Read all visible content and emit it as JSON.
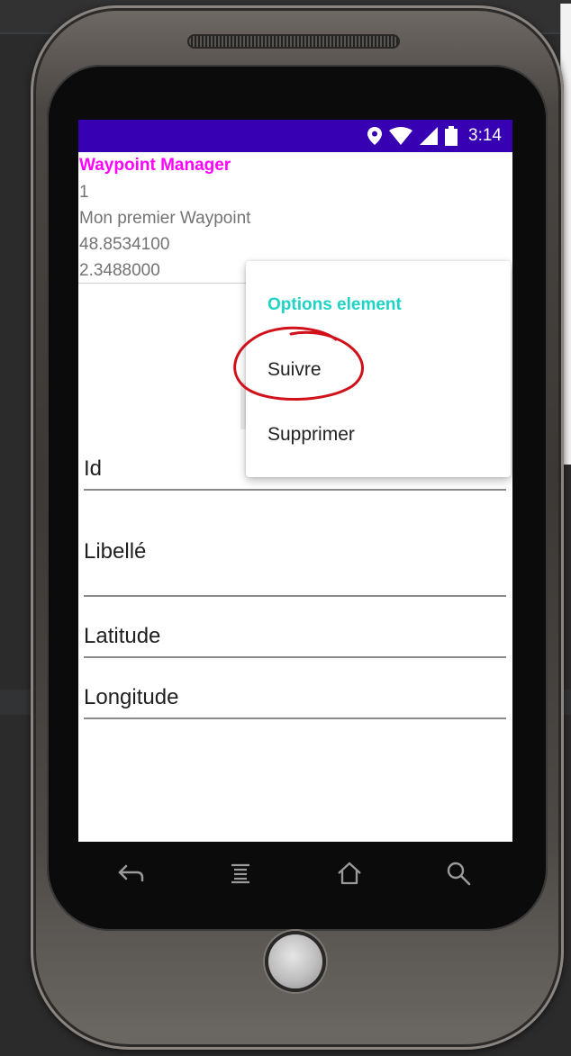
{
  "status_bar": {
    "time": "3:14",
    "background_color": "#3700b3",
    "icons": [
      "location-icon",
      "wifi-icon",
      "signal-icon",
      "battery-icon"
    ]
  },
  "app": {
    "title": "Waypoint Manager",
    "title_color": "#ff00ff",
    "item": {
      "id": "1",
      "label": "Mon premier Waypoint",
      "latitude": "48.8534100",
      "longitude": "2.3488000"
    }
  },
  "form": {
    "id_label": "Id",
    "label_label": "Libellé",
    "latitude_label": "Latitude",
    "longitude_label": "Longitude"
  },
  "context_menu": {
    "header": "Options element",
    "header_color": "#1fd3c4",
    "items": [
      {
        "label": "Suivre"
      },
      {
        "label": "Supprimer"
      }
    ]
  },
  "annotation": {
    "circle_color": "#d0111a",
    "target": "Suivre"
  },
  "navigation": {
    "icons": [
      "back-icon",
      "menu-icon",
      "home-icon",
      "search-icon"
    ]
  }
}
